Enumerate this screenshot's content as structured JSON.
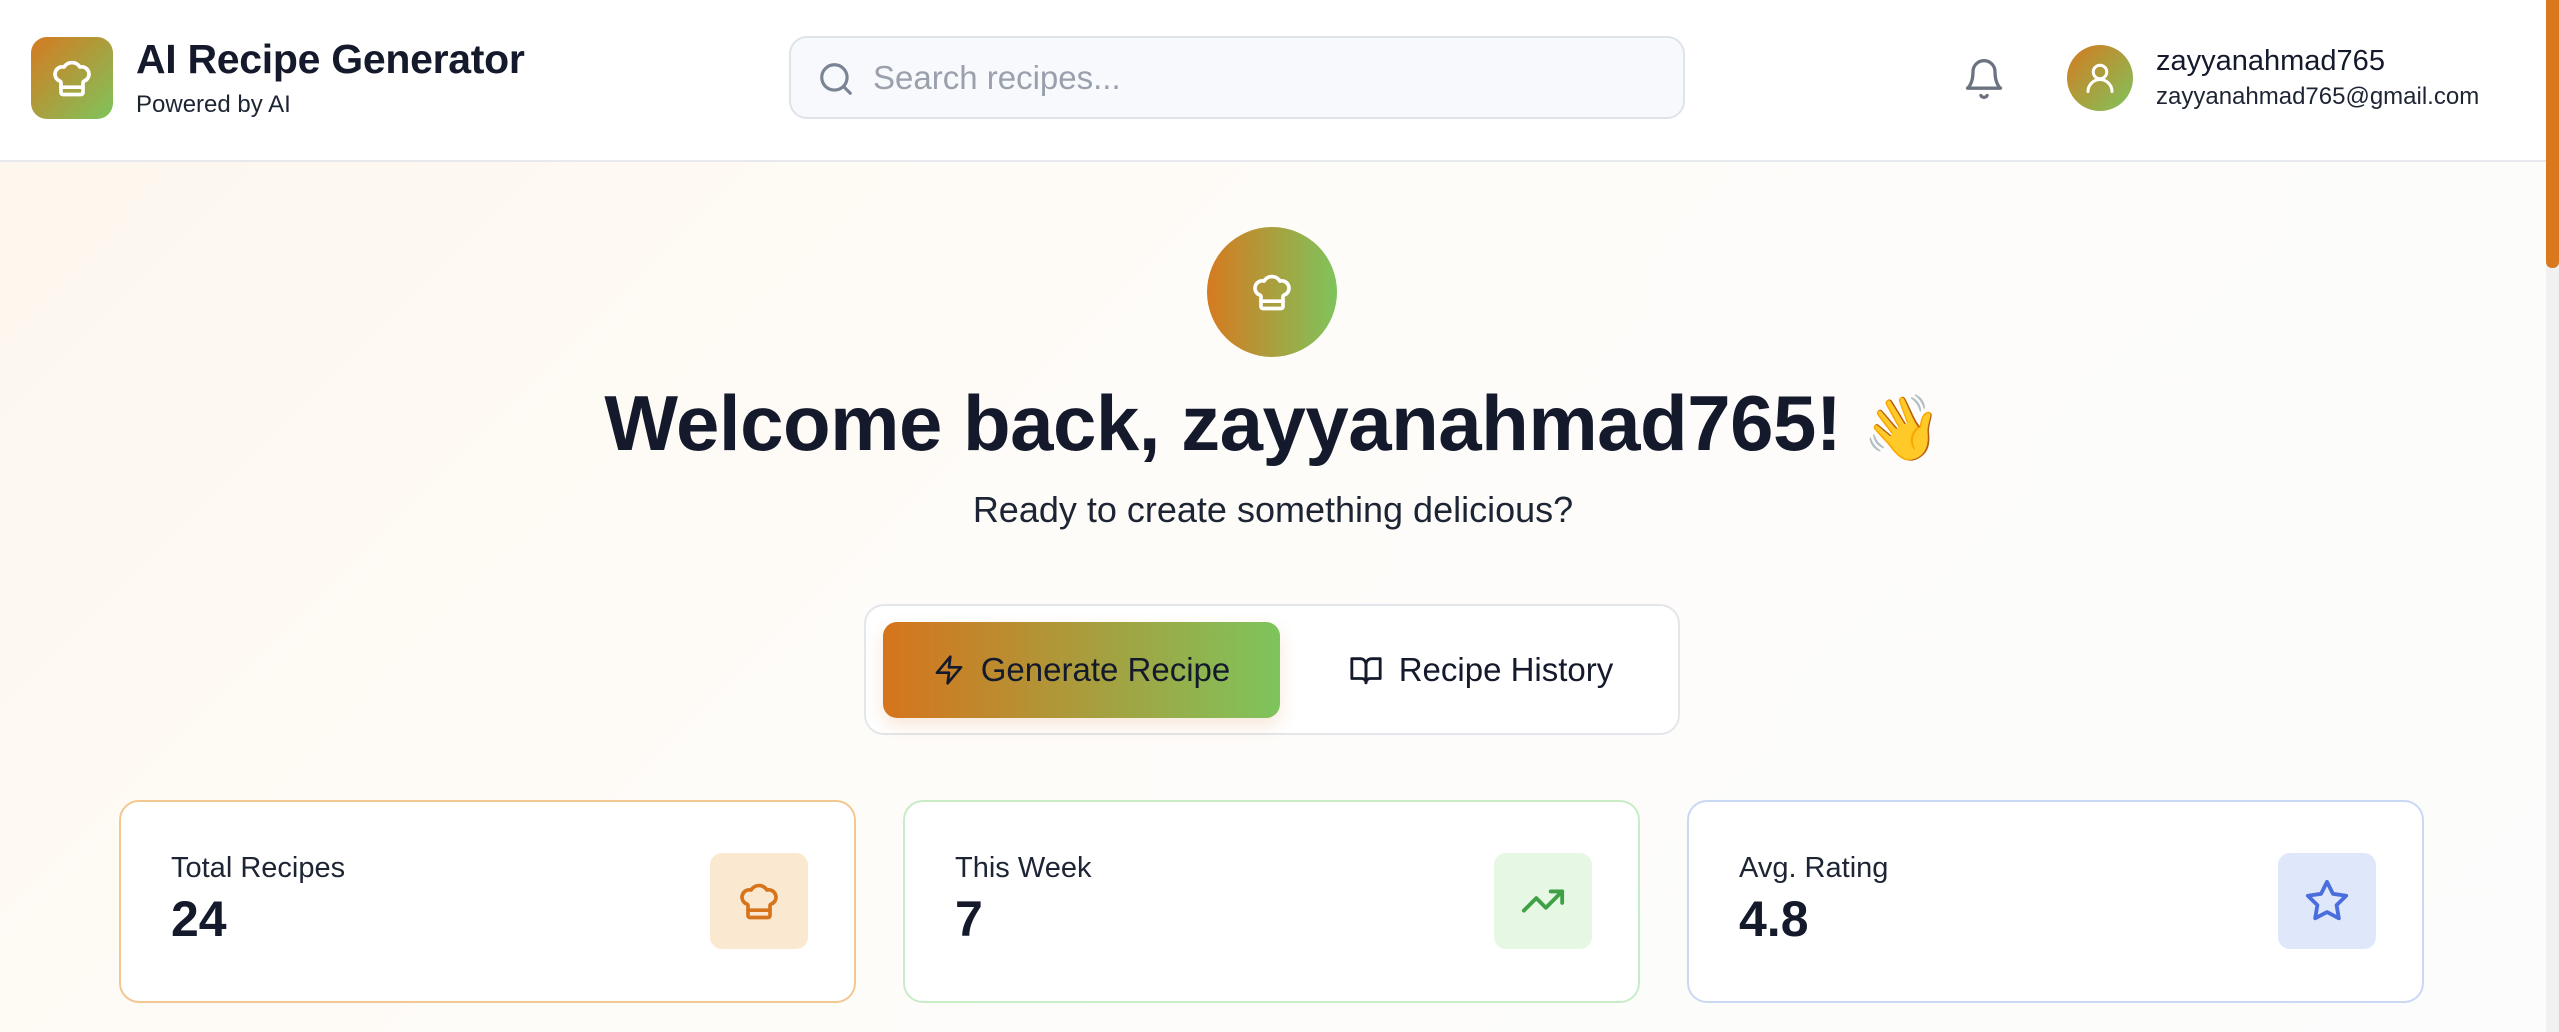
{
  "app": {
    "title": "AI Recipe Generator",
    "subtitle": "Powered by AI",
    "logo_icon": "chef-hat-icon"
  },
  "search": {
    "placeholder": "Search recipes...",
    "value": ""
  },
  "header": {
    "notification_icon": "bell-icon"
  },
  "user": {
    "username": "zayyanahmad765",
    "email": "zayyanahmad765@gmail.com",
    "avatar_icon": "user-icon"
  },
  "hero": {
    "icon": "chef-hat-icon",
    "welcome_text": "Welcome back, zayyanahmad765!",
    "wave_emoji": "👋",
    "tagline": "Ready to create something delicious?"
  },
  "tabs": [
    {
      "label": "Generate Recipe",
      "icon": "lightning-icon",
      "active": true
    },
    {
      "label": "Recipe History",
      "icon": "book-icon",
      "active": false
    }
  ],
  "stats": [
    {
      "label": "Total Recipes",
      "value": "24",
      "icon": "chef-hat-icon",
      "accent": "#d6741c"
    },
    {
      "label": "This Week",
      "value": "7",
      "icon": "trending-up-icon",
      "accent": "#3fa046"
    },
    {
      "label": "Avg. Rating",
      "value": "4.8",
      "icon": "star-icon",
      "accent": "#4a6fdc"
    }
  ],
  "colors": {
    "brand_orange": "#d6741c",
    "brand_green": "#7ec45c",
    "text_dark": "#141a2b"
  }
}
